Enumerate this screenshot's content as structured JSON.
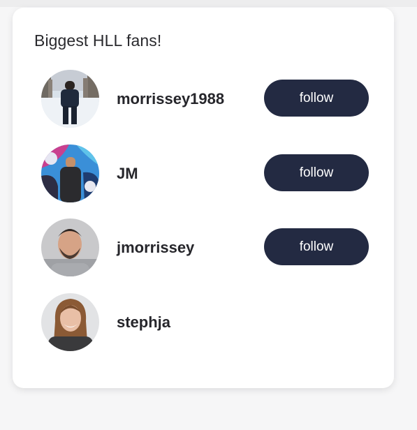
{
  "card": {
    "title": "Biggest HLL fans!"
  },
  "users": [
    {
      "username": "morrissey1988",
      "follow_label": "follow",
      "avatar_icon": "person-in-snow-avatar"
    },
    {
      "username": "JM",
      "follow_label": "follow",
      "avatar_icon": "person-graffiti-wall-avatar"
    },
    {
      "username": "jmorrissey",
      "follow_label": "follow",
      "avatar_icon": "bearded-man-avatar"
    },
    {
      "username": "stephja",
      "avatar_icon": "smiling-woman-avatar"
    }
  ],
  "colors": {
    "button_bg": "#232a42",
    "button_text": "#ffffff",
    "card_bg": "#ffffff",
    "page_bg": "#f6f6f7"
  }
}
